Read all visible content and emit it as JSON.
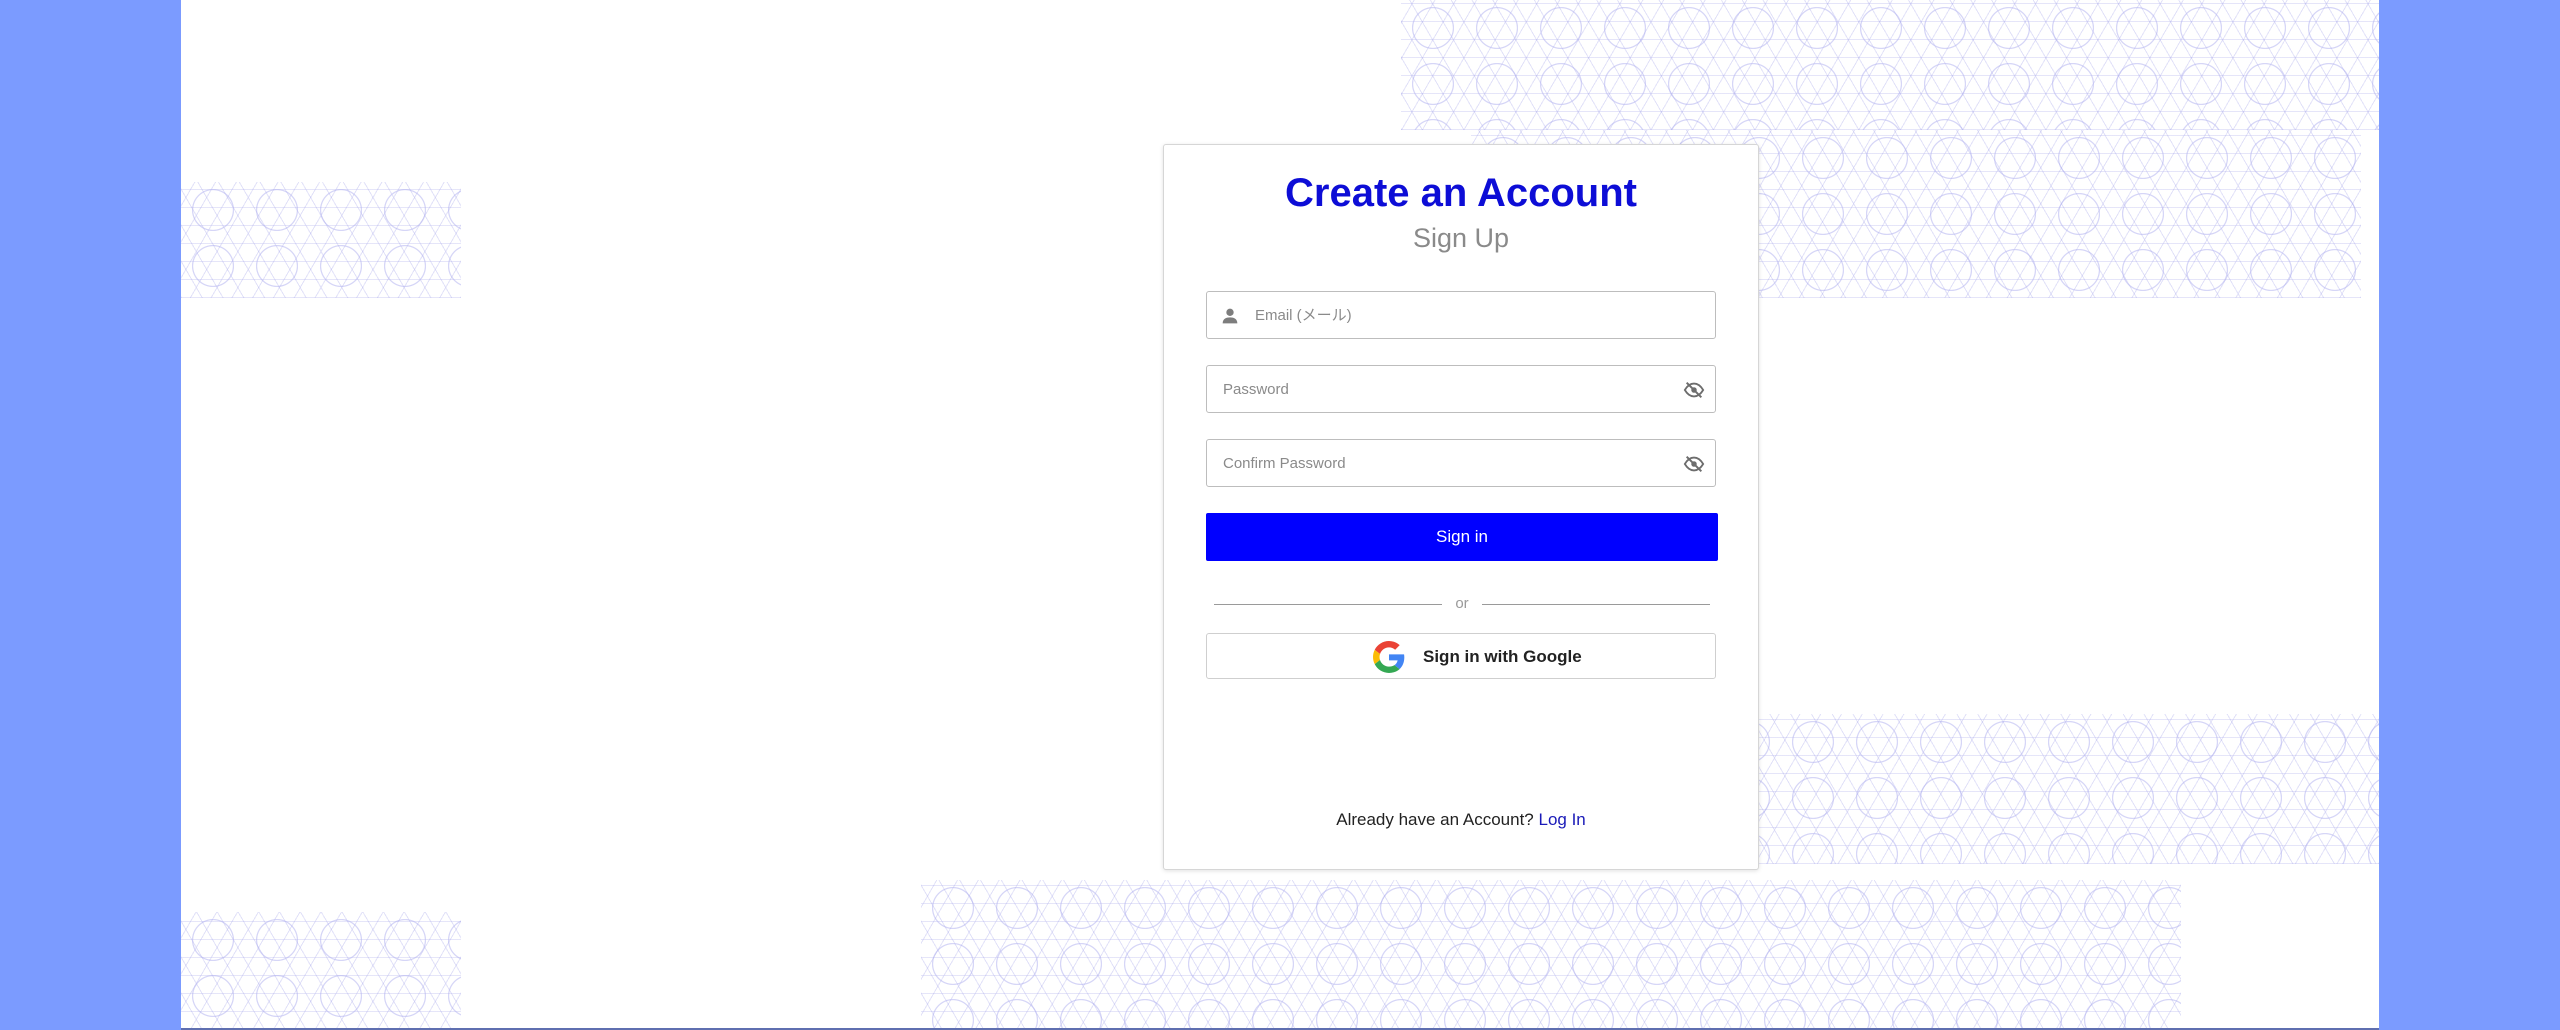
{
  "card": {
    "title": "Create an Account",
    "subtitle": "Sign Up"
  },
  "form": {
    "email_placeholder": "Email (メール)",
    "email_value": "",
    "password_placeholder": "Password",
    "password_value": "",
    "confirm_placeholder": "Confirm Password",
    "confirm_value": "",
    "signin_label": "Sign in",
    "divider_text": "or",
    "google_label": "Sign in with Google"
  },
  "footer": {
    "prompt": "Already have an Account?",
    "link_label": "Log In"
  },
  "icons": {
    "email": "person-icon",
    "password_toggle": "eye-slash-icon",
    "google": "google-g-icon"
  },
  "colors": {
    "accent": "#0000ff",
    "title": "#0d0dd6",
    "link": "#1a1ab8",
    "side_background": "#7b9bff",
    "pattern": "#b4b4f0"
  }
}
